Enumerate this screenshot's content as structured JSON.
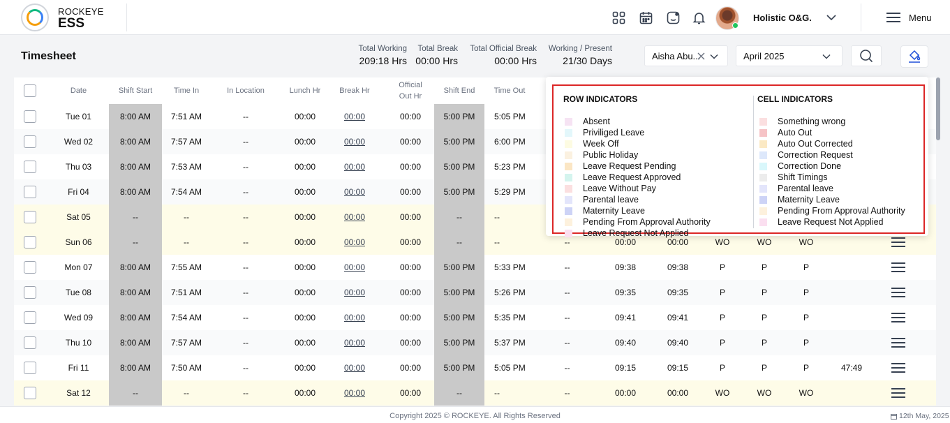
{
  "header": {
    "brand_top": "ROCKEYE",
    "brand_bottom": "ESS",
    "org_name": "Holistic O&G.",
    "menu_label": "Menu",
    "icons": [
      "apps-grid-icon",
      "calendar-icon",
      "chat-badge-icon",
      "bell-icon"
    ]
  },
  "toolbar": {
    "title": "Timesheet",
    "stats": [
      {
        "label": "Total Working",
        "value": "209:18 Hrs"
      },
      {
        "label": "Total Break",
        "value": "00:00 Hrs"
      },
      {
        "label": "Total Official Break",
        "value": "00:00 Hrs"
      },
      {
        "label": "Working / Present",
        "value": "21/30 Days"
      }
    ],
    "employee_value": "Aisha Abu...",
    "month_value": "April 2025"
  },
  "table": {
    "columns": [
      "Date",
      "Shift Start",
      "Time In",
      "In Location",
      "Lunch Hr",
      "Break Hr",
      "Official Out Hr",
      "Shift End",
      "Time Out"
    ],
    "rows": [
      {
        "type": "weekday",
        "cells": [
          "Tue 01",
          "8:00 AM",
          "7:51 AM",
          "--",
          "00:00",
          "00:00",
          "00:00",
          "5:00 PM",
          "5:05 PM"
        ],
        "extra": []
      },
      {
        "type": "weekday",
        "cells": [
          "Wed 02",
          "8:00 AM",
          "7:57 AM",
          "--",
          "00:00",
          "00:00",
          "00:00",
          "5:00 PM",
          "6:00 PM"
        ],
        "extra": []
      },
      {
        "type": "weekday",
        "cells": [
          "Thu 03",
          "8:00 AM",
          "7:53 AM",
          "--",
          "00:00",
          "00:00",
          "00:00",
          "5:00 PM",
          "5:23 PM"
        ],
        "extra": []
      },
      {
        "type": "weekday",
        "cells": [
          "Fri 04",
          "8:00 AM",
          "7:54 AM",
          "--",
          "00:00",
          "00:00",
          "00:00",
          "5:00 PM",
          "5:29 PM"
        ],
        "extra": []
      },
      {
        "type": "weekend",
        "cells": [
          "Sat 05",
          "--",
          "--",
          "--",
          "00:00",
          "00:00",
          "00:00",
          "--",
          "--"
        ],
        "extra": []
      },
      {
        "type": "weekend",
        "cells": [
          "Sun 06",
          "--",
          "--",
          "--",
          "00:00",
          "00:00",
          "00:00",
          "--",
          "--"
        ],
        "extra": [
          "--",
          "00:00",
          "00:00",
          "WO",
          "WO",
          "WO",
          ""
        ]
      },
      {
        "type": "weekday",
        "cells": [
          "Mon 07",
          "8:00 AM",
          "7:55 AM",
          "--",
          "00:00",
          "00:00",
          "00:00",
          "5:00 PM",
          "5:33 PM"
        ],
        "extra": [
          "--",
          "09:38",
          "09:38",
          "P",
          "P",
          "P",
          ""
        ]
      },
      {
        "type": "weekday",
        "cells": [
          "Tue 08",
          "8:00 AM",
          "7:51 AM",
          "--",
          "00:00",
          "00:00",
          "00:00",
          "5:00 PM",
          "5:26 PM"
        ],
        "extra": [
          "--",
          "09:35",
          "09:35",
          "P",
          "P",
          "P",
          ""
        ]
      },
      {
        "type": "weekday",
        "cells": [
          "Wed 09",
          "8:00 AM",
          "7:54 AM",
          "--",
          "00:00",
          "00:00",
          "00:00",
          "5:00 PM",
          "5:35 PM"
        ],
        "extra": [
          "--",
          "09:41",
          "09:41",
          "P",
          "P",
          "P",
          ""
        ]
      },
      {
        "type": "weekday",
        "cells": [
          "Thu 10",
          "8:00 AM",
          "7:57 AM",
          "--",
          "00:00",
          "00:00",
          "00:00",
          "5:00 PM",
          "5:37 PM"
        ],
        "extra": [
          "--",
          "09:40",
          "09:40",
          "P",
          "P",
          "P",
          ""
        ]
      },
      {
        "type": "weekday",
        "cells": [
          "Fri 11",
          "8:00 AM",
          "7:50 AM",
          "--",
          "00:00",
          "00:00",
          "00:00",
          "5:00 PM",
          "5:05 PM"
        ],
        "extra": [
          "--",
          "09:15",
          "09:15",
          "P",
          "P",
          "P",
          "47:49"
        ]
      },
      {
        "type": "weekend",
        "cells": [
          "Sat 12",
          "--",
          "--",
          "--",
          "00:00",
          "00:00",
          "00:00",
          "--",
          "--"
        ],
        "extra": [
          "--",
          "00:00",
          "00:00",
          "WO",
          "WO",
          "WO",
          ""
        ]
      }
    ]
  },
  "legend": {
    "row_title": "ROW INDICATORS",
    "cell_title": "CELL INDICATORS",
    "row_items": [
      {
        "label": "Absent",
        "color": "#f6e3f3"
      },
      {
        "label": "Priviliged Leave",
        "color": "#e3f7fb"
      },
      {
        "label": "Week Off",
        "color": "#fdfbe2"
      },
      {
        "label": "Public Holiday",
        "color": "#fbf1e0"
      },
      {
        "label": "Leave Request Pending",
        "color": "#fbe6c4"
      },
      {
        "label": "Leave Request Approved",
        "color": "#d4f4ee"
      },
      {
        "label": "Leave Without Pay",
        "color": "#fbdfe0"
      },
      {
        "label": "Parental leave",
        "color": "#e3e5fb"
      },
      {
        "label": "Maternity Leave",
        "color": "#cdd3f6"
      },
      {
        "label": "Pending From Approval Authority",
        "color": "#fdf1dd"
      },
      {
        "label": "Leave Request Not Applied",
        "color": "#fbdff0"
      }
    ],
    "cell_items": [
      {
        "label": "Something wrong",
        "color": "#fbdfe0"
      },
      {
        "label": "Auto Out",
        "color": "#f6c3c6"
      },
      {
        "label": "Auto Out Corrected",
        "color": "#fbe9c4"
      },
      {
        "label": "Correction Request",
        "color": "#dde8fb"
      },
      {
        "label": "Correction Done",
        "color": "#d9f7fb"
      },
      {
        "label": "Shift Timings",
        "color": "#ececec"
      },
      {
        "label": "Parental leave",
        "color": "#e3e5fb"
      },
      {
        "label": "Maternity Leave",
        "color": "#cdd3f6"
      },
      {
        "label": "Pending From Approval Authority",
        "color": "#fdf1dd"
      },
      {
        "label": "Leave Request Not Applied",
        "color": "#fbdff0"
      }
    ]
  },
  "footer": {
    "copyright": "Copyright 2025 © ROCKEYE. All Rights Reserved",
    "date": "12th May, 2025"
  }
}
